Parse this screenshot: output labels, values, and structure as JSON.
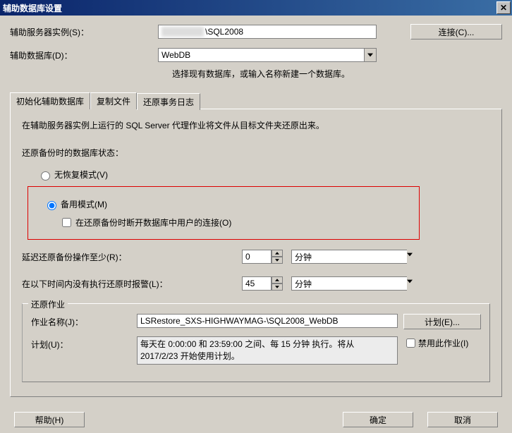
{
  "window": {
    "title": "辅助数据库设置"
  },
  "server": {
    "label": "辅助服务器实例(S)：",
    "value": "\\SQL2008",
    "connect_btn": "连接(C)..."
  },
  "database": {
    "label": "辅助数据库(D)：",
    "value": "WebDB",
    "hint": "选择现有数据库，或输入名称新建一个数据库。"
  },
  "tabs": {
    "init": "初始化辅助数据库",
    "copy": "复制文件",
    "restore": "还原事务日志"
  },
  "panel": {
    "desc": "在辅助服务器实例上运行的 SQL Server 代理作业将文件从目标文件夹还原出来。",
    "state_label": "还原备份时的数据库状态：",
    "no_recovery": "无恢复模式(V)",
    "standby": "备用模式(M)",
    "disconnect": "在还原备份时断开数据库中用户的连接(O)",
    "delay": {
      "label": "延迟还原备份操作至少(R)：",
      "value": "0",
      "unit": "分钟"
    },
    "alert": {
      "label": "在以下时间内没有执行还原时报警(L)：",
      "value": "45",
      "unit": "分钟"
    }
  },
  "job": {
    "legend": "还原作业",
    "name_label": "作业名称(J)：",
    "name_value": "LSRestore_SXS-HIGHWAYMAG-\\SQL2008_WebDB",
    "sched_label": "计划(U)：",
    "sched_text": "每天在 0:00:00 和 23:59:00 之间、每 15 分钟 执行。将从 2017/2/23 开始使用计划。",
    "plan_btn": "计划(E)...",
    "disable_label": "禁用此作业(I)"
  },
  "footer": {
    "help": "帮助(H)",
    "ok": "确定",
    "cancel": "取消"
  }
}
